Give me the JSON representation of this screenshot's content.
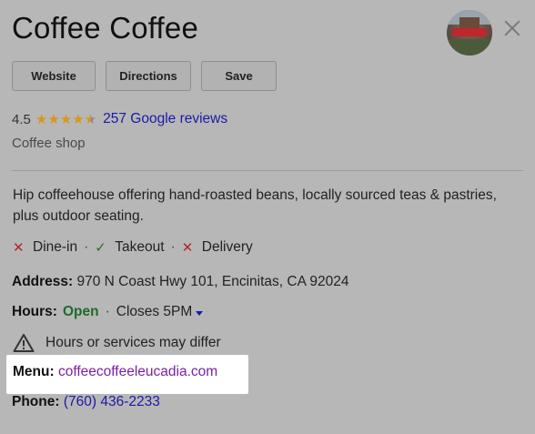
{
  "business": {
    "name": "Coffee Coffee",
    "rating": "4.5",
    "reviews_label": "257 Google reviews",
    "category": "Coffee shop",
    "description": "Hip coffeehouse offering hand-roasted beans, locally sourced teas & pastries, plus outdoor seating."
  },
  "actions": {
    "website": "Website",
    "directions": "Directions",
    "save": "Save"
  },
  "services": {
    "dine_in": "Dine-in",
    "takeout": "Takeout",
    "delivery": "Delivery",
    "separator": "·"
  },
  "info": {
    "address_label": "Address:",
    "address_value": "970 N Coast Hwy 101, Encinitas, CA 92024",
    "hours_label": "Hours:",
    "hours_status": "Open",
    "hours_sep": "·",
    "hours_close": "Closes 5PM",
    "warning": "Hours or services may differ",
    "menu_label": "Menu:",
    "menu_link": "coffeecoffeeleucadia.com",
    "phone_label": "Phone:",
    "phone_value": "(760) 436-2233"
  },
  "icons": {
    "close": "close-icon",
    "dine_in": "x-icon",
    "takeout": "check-icon",
    "delivery": "x-icon",
    "warning": "warning-triangle-icon",
    "hours_expand": "caret-down-icon"
  },
  "colors": {
    "background": "#b7b7b7",
    "link_blue": "#1a1aa6",
    "visited_purple": "#7b1fa2",
    "open_green": "#1c6b2c",
    "star": "#d8961c",
    "no_red": "#b3262b"
  }
}
